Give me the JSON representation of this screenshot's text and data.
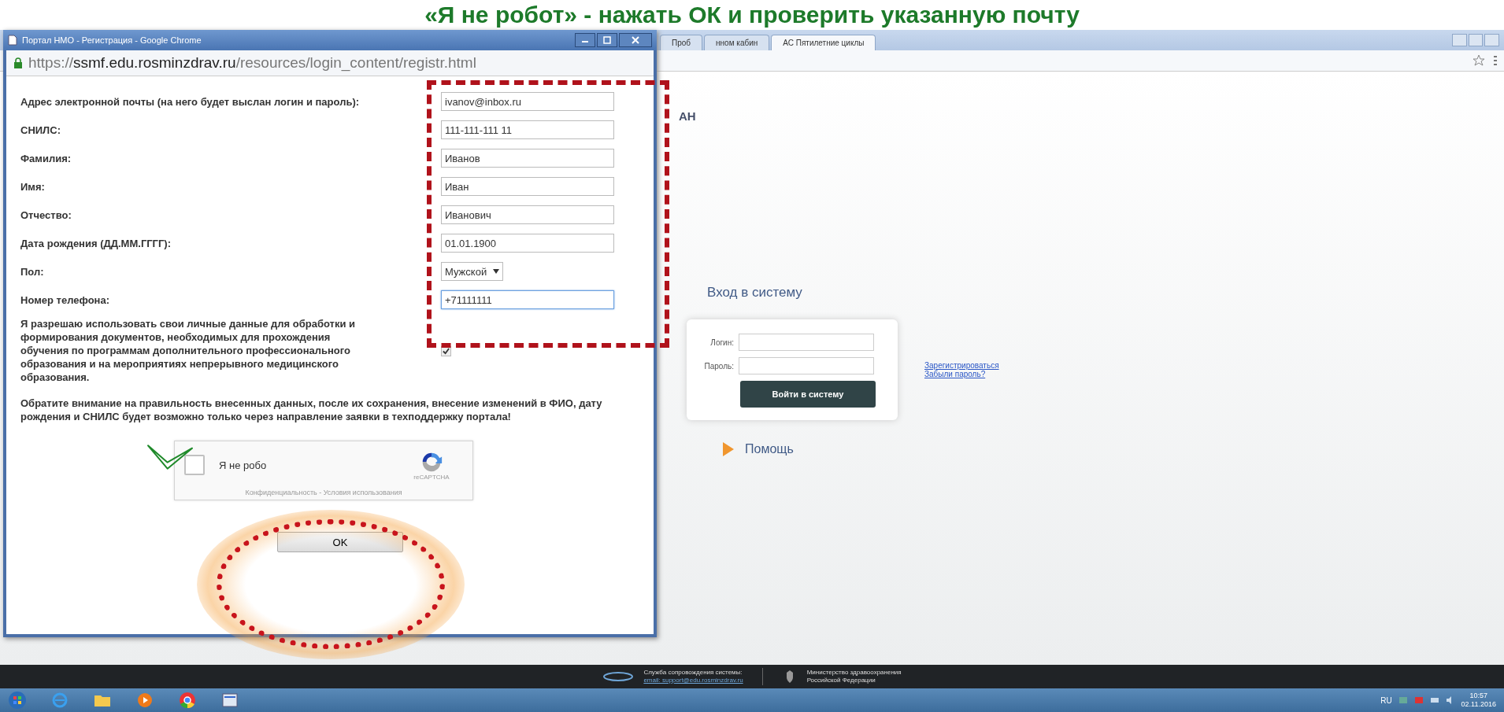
{
  "heading": "«Я не робот» - нажать ОК и проверить указанную почту",
  "browser": {
    "tabs": [
      {
        "label": "Проб",
        "selected": false
      },
      {
        "label": "нном кабин",
        "selected": false
      },
      {
        "label": "АС Пятилетние циклы",
        "selected": true
      }
    ],
    "partial_text": "АН",
    "login": {
      "title": "Вход в систему",
      "fields": [
        {
          "label": "Логин:"
        },
        {
          "label": "Пароль:"
        }
      ],
      "submit": "Войти в систему",
      "links": [
        "Зарегистрироваться",
        "Забыли пароль?"
      ],
      "help": "Помощь"
    },
    "footer": {
      "support_label": "Служба сопровождения системы:",
      "support_email": "email: support@edu.rosminzdrav.ru",
      "ministry": [
        "Министерство здравоохранения",
        "Российской Федерации"
      ]
    }
  },
  "popup": {
    "title": "Портал НМО - Регистрация - Google Chrome",
    "url": "https://**ssmf.edu.rosminzdrav.ru**/resources/login_content/registr.html",
    "fields": [
      {
        "label": "Адрес электронной почты (на него будет выслан логин и пароль):",
        "value": "ivanov@inbox.ru",
        "kind": "text",
        "focused": false
      },
      {
        "label": "СНИЛС:",
        "value": "111-111-111 11",
        "kind": "text",
        "focused": false
      },
      {
        "label": "Фамилия:",
        "value": "Иванов",
        "kind": "text",
        "focused": false
      },
      {
        "label": "Имя:",
        "value": "Иван",
        "kind": "text",
        "focused": false
      },
      {
        "label": "Отчество:",
        "value": "Иванович",
        "kind": "text",
        "focused": false
      },
      {
        "label": "Дата рождения (ДД.ММ.ГГГГ):",
        "value": "01.01.1900",
        "kind": "text",
        "focused": false
      },
      {
        "label": "Пол:",
        "value": "Мужской",
        "kind": "select",
        "focused": false
      },
      {
        "label": "Номер телефона:",
        "value": "+71111111",
        "kind": "text",
        "focused": true
      }
    ],
    "consent": {
      "text": "Я разрешаю использовать свои личные данные для обработки и формирования документов, необходимых для прохождения обучения по программам дополнительного профессионального образования и на мероприятиях непрерывного медицинского образования.",
      "checked": true
    },
    "notice": "Обратите внимание на правильность внесенных данных, после их сохранения, внесение изменений в ФИО, дату рождения и СНИЛС будет возможно только через направление заявки в техподдержку портала!",
    "captcha": {
      "label": "Я не робо",
      "checked": false,
      "brand": "reCAPTCHA",
      "terms": "Конфиденциальность - Условия использования"
    },
    "ok": "OK"
  },
  "taskbar": {
    "language": "RU",
    "time": "10:57",
    "date": "02.11.2016"
  }
}
